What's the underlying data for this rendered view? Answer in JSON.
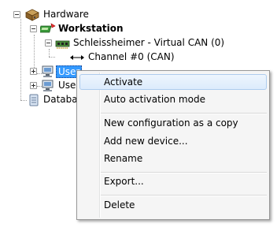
{
  "tree": {
    "root_label": "Hardware",
    "workstation_label": "Workstation",
    "device_label": "Schleissheimer - Virtual CAN (0)",
    "channel_label": "Channel #0 (CAN)",
    "user1_label": "User",
    "user2_label": "User",
    "database_label": "Databas"
  },
  "context_menu": {
    "items": [
      {
        "label": "Activate"
      },
      {
        "label": "Auto activation mode"
      },
      {
        "label": "New configuration as a copy"
      },
      {
        "label": "Add new device..."
      },
      {
        "label": "Rename"
      },
      {
        "label": "Export..."
      },
      {
        "label": "Delete"
      }
    ]
  },
  "colors": {
    "selection": "#3399ff",
    "menu_background": "#f5f5f5",
    "menu_hover": "#dcebfc"
  },
  "icons": {
    "root": "hardware-icon",
    "workstation": "workstation-icon",
    "device": "can-card-icon",
    "channel": "channel-arrow-icon",
    "user": "user-computer-icon",
    "database": "database-icon"
  }
}
